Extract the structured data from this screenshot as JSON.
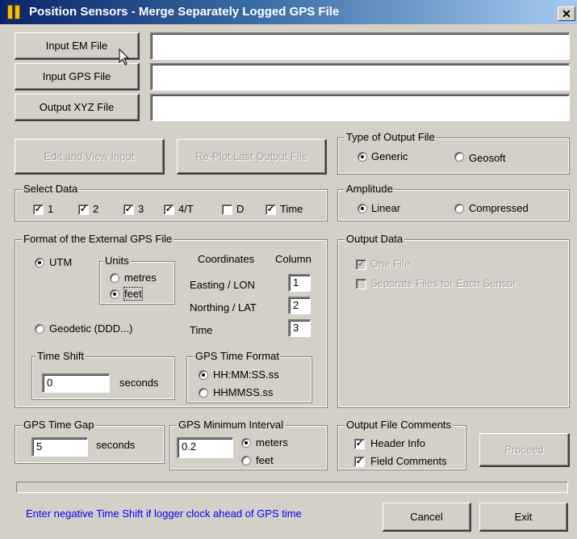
{
  "window": {
    "title": "Position Sensors - Merge Separately Logged GPS File",
    "close_glyph": "✕"
  },
  "files": {
    "input_em_label": "Input EM File",
    "input_em_value": "",
    "input_gps_label": "Input GPS File",
    "input_gps_value": "",
    "output_xyz_label": "Output XYZ File",
    "output_xyz_value": ""
  },
  "actions": {
    "edit_view_label": "Edit and View Input",
    "replot_label": "Re-Plot Last Output File",
    "proceed_label": "Proceed",
    "cancel_label": "Cancel",
    "exit_label": "Exit"
  },
  "output_type": {
    "legend": "Type of Output File",
    "options": [
      {
        "label": "Generic",
        "selected": true
      },
      {
        "label": "Geosoft",
        "selected": false
      }
    ]
  },
  "select_data": {
    "legend": "Select Data",
    "items": [
      {
        "label": "1",
        "checked": true
      },
      {
        "label": "2",
        "checked": true
      },
      {
        "label": "3",
        "checked": true
      },
      {
        "label": "4/T",
        "checked": true
      },
      {
        "label": "D",
        "checked": false
      },
      {
        "label": "Time",
        "checked": true
      }
    ]
  },
  "amplitude": {
    "legend": "Amplitude",
    "options": [
      {
        "label": "Linear",
        "selected": true
      },
      {
        "label": "Compressed",
        "selected": false
      }
    ]
  },
  "gps_format": {
    "legend": "Format of the External GPS File",
    "utm_label": "UTM",
    "geodetic_label": "Geodetic (DDD...)",
    "units_legend": "Units",
    "units_metres": "metres",
    "units_feet": "feet",
    "coordinates_header": "Coordinates",
    "column_header": "Column",
    "easting_label": "Easting / LON",
    "easting_col": "1",
    "northing_label": "Northing / LAT",
    "northing_col": "2",
    "time_label": "Time",
    "time_col": "3",
    "time_shift_legend": "Time Shift",
    "time_shift_value": "0",
    "time_shift_unit": "seconds",
    "time_format_legend": "GPS Time Format",
    "time_format_a": "HH:MM:SS.ss",
    "time_format_b": "HHMMSS.ss"
  },
  "output_data": {
    "legend": "Output Data",
    "one_file": "One File",
    "separate_files": "Separate Files for Each Sensor"
  },
  "gps_gap": {
    "legend": "GPS Time Gap",
    "value": "5",
    "unit": "seconds"
  },
  "gps_min_interval": {
    "legend": "GPS Minimum Interval",
    "value": "0.2",
    "meters": "meters",
    "feet": "feet"
  },
  "output_comments": {
    "legend": "Output File Comments",
    "header_info": "Header Info",
    "field_comments": "Field Comments"
  },
  "status": {
    "hint": "Enter negative Time Shift if logger clock ahead of GPS time"
  }
}
